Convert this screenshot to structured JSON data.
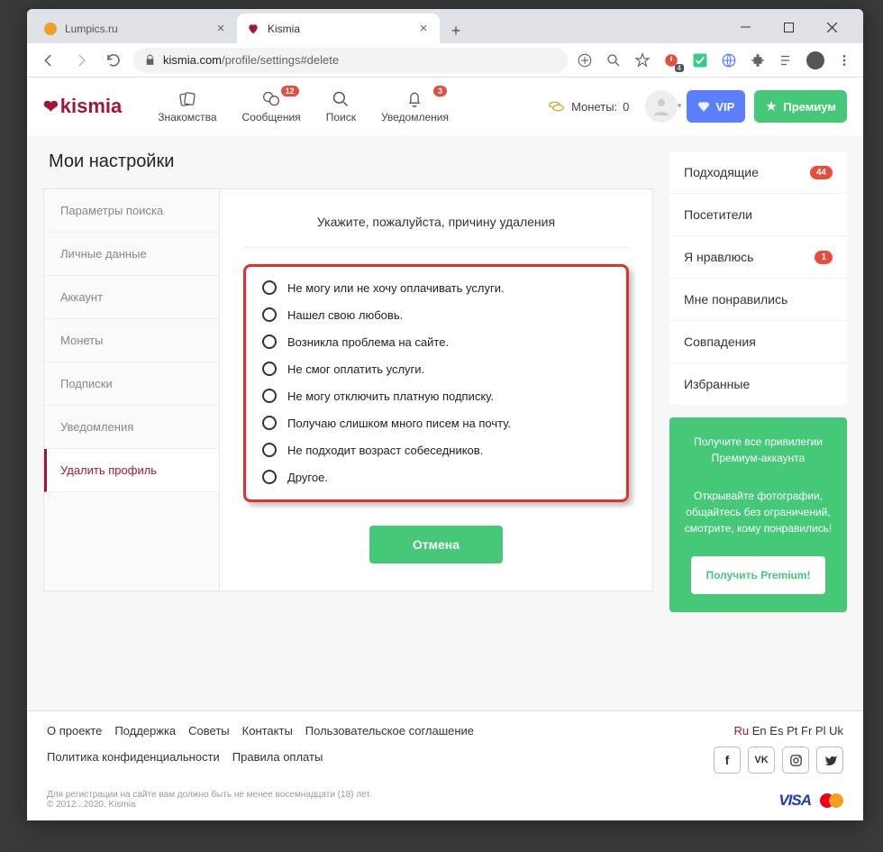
{
  "tabs": [
    {
      "title": "Lumpics.ru",
      "icon_color": "#f0a020"
    },
    {
      "title": "Kismia",
      "icon_color": "#a01838"
    }
  ],
  "url": {
    "domain": "kismia.com",
    "path": "/profile/settings#delete"
  },
  "ext_badge": "4",
  "logo": "kismia",
  "nav": {
    "0": {
      "label": "Знакомства"
    },
    "1": {
      "label": "Сообщения",
      "badge": "12"
    },
    "2": {
      "label": "Поиск"
    },
    "3": {
      "label": "Уведомления",
      "badge": "3"
    }
  },
  "coins_label": "Монеты:",
  "coins_value": "0",
  "vip_label": "VIP",
  "premium_label": "Премиум",
  "page_title": "Мои настройки",
  "settings_nav": {
    "0": "Параметры поиска",
    "1": "Личные данные",
    "2": "Аккаунт",
    "3": "Монеты",
    "4": "Подписки",
    "5": "Уведомления",
    "6": "Удалить профиль"
  },
  "form_title": "Укажите, пожалуйста, причину удаления",
  "reasons": {
    "0": "Не могу или не хочу оплачивать услуги.",
    "1": "Нашел свою любовь.",
    "2": "Возникла проблема на сайте.",
    "3": "Не смог оплатить услуги.",
    "4": "Не могу отключить платную подписку.",
    "5": "Получаю слишком много писем на почту.",
    "6": "Не подходит возраст собеседников.",
    "7": "Другое."
  },
  "cancel_label": "Отмена",
  "side": {
    "0": {
      "label": "Подходящие",
      "badge": "44"
    },
    "1": {
      "label": "Посетители"
    },
    "2": {
      "label": "Я нравлюсь",
      "badge": "1"
    },
    "3": {
      "label": "Мне понравились"
    },
    "4": {
      "label": "Совпадения"
    },
    "5": {
      "label": "Избранные"
    }
  },
  "promo": {
    "title": "Получите все привилегии Премиум-аккаунта",
    "text": "Открывайте фотографии, общайтесь без ограничений, смотрите, кому понравились!",
    "button": "Получить Premium!"
  },
  "footer_links": {
    "0": "О проекте",
    "1": "Поддержка",
    "2": "Советы",
    "3": "Контакты",
    "4": "Пользовательское соглашение",
    "5": "Политика конфиденциальности",
    "6": "Правила оплаты"
  },
  "langs": {
    "0": "Ru",
    "1": "En",
    "2": "Es",
    "3": "Pt",
    "4": "Fr",
    "5": "Pl",
    "6": "Uk"
  },
  "legal_line1": "Для регистрации на сайте вам должно быть не менее восемнадцати (18) лет.",
  "legal_line2": "© 2012...2020, Kismia",
  "visa": "VISA"
}
